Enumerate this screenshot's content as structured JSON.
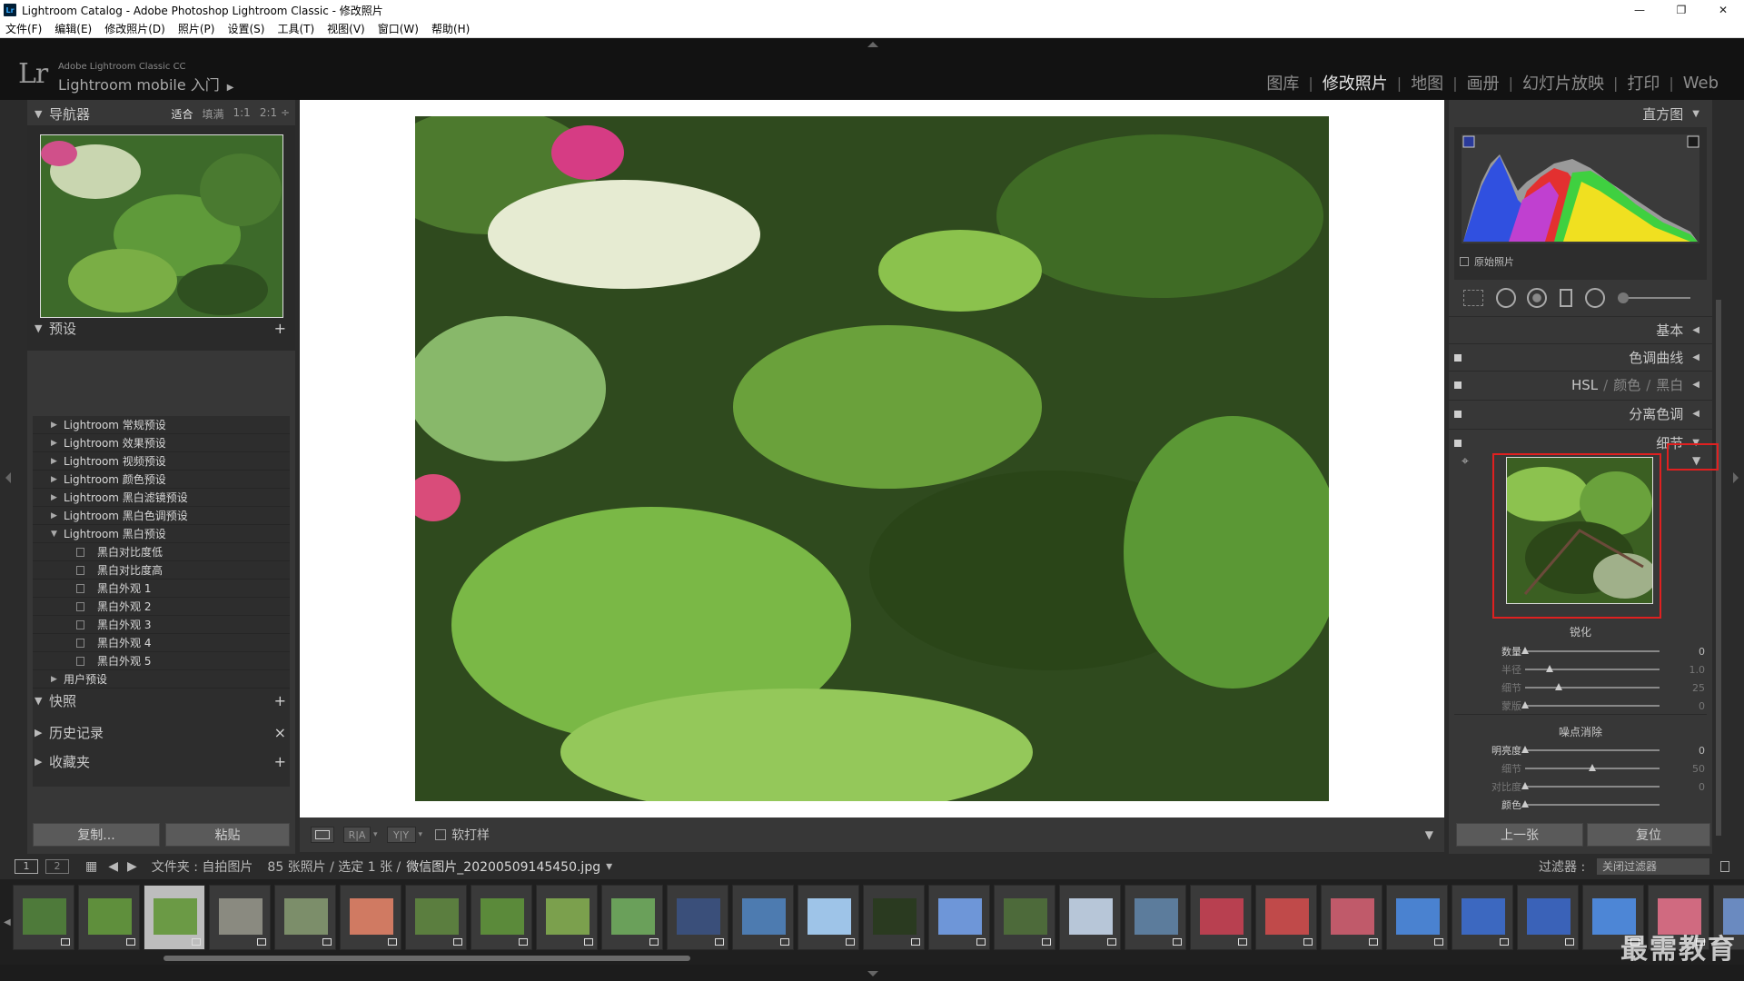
{
  "window": {
    "title": "Lightroom Catalog - Adobe Photoshop Lightroom Classic - 修改照片",
    "app_badge": "Lr",
    "controls": [
      "—",
      "❐",
      "✕"
    ]
  },
  "menubar": [
    "文件(F)",
    "编辑(E)",
    "修改照片(D)",
    "照片(P)",
    "设置(S)",
    "工具(T)",
    "视图(V)",
    "窗口(W)",
    "帮助(H)"
  ],
  "identity": {
    "logo": "Lr",
    "small": "Adobe Lightroom Classic CC",
    "big": "Lightroom mobile 入门",
    "play_icon": "▶"
  },
  "modules": [
    {
      "label": "图库",
      "active": false
    },
    {
      "label": "修改照片",
      "active": true
    },
    {
      "label": "地图",
      "active": false
    },
    {
      "label": "画册",
      "active": false
    },
    {
      "label": "幻灯片放映",
      "active": false
    },
    {
      "label": "打印",
      "active": false
    },
    {
      "label": "Web",
      "active": false
    }
  ],
  "left": {
    "navigator": {
      "title": "导航器",
      "options": [
        "适合",
        "填满",
        "1:1",
        "2:1 ÷"
      ],
      "current": "适合"
    },
    "presets": {
      "title": "预设",
      "groups": [
        "Lightroom 常规预设",
        "Lightroom 效果预设",
        "Lightroom 视频预设",
        "Lightroom 颜色预设",
        "Lightroom 黑白滤镜预设",
        "Lightroom 黑白色调预设"
      ],
      "open_group": "Lightroom 黑白预设",
      "children": [
        "黑白对比度低",
        "黑白对比度高",
        "黑白外观 1",
        "黑白外观 2",
        "黑白外观 3",
        "黑白外观 4",
        "黑白外观 5"
      ],
      "user_group": "用户预设"
    },
    "snapshots": "快照",
    "history": "历史记录",
    "collections": "收藏夹",
    "copy_button": "复制...",
    "paste_button": "粘贴"
  },
  "toolbar": {
    "view_ra": "R|A",
    "view_yy": "Y|Y",
    "softproof_label": "软打样"
  },
  "right": {
    "histogram_title": "直方图",
    "original_photo": "原始照片",
    "panels": {
      "basic": "基本",
      "tone_curve": "色调曲线",
      "hsl_parts": [
        "HSL",
        "/",
        "颜色",
        "/",
        "黑白"
      ],
      "split_toning": "分离色调",
      "detail": "细节"
    },
    "sharpening": {
      "title": "锐化",
      "rows": [
        {
          "label": "数量",
          "value": "0",
          "pos": 0.0
        },
        {
          "label": "半径",
          "value": "1.0",
          "pos": 0.18
        },
        {
          "label": "细节",
          "value": "25",
          "pos": 0.25
        },
        {
          "label": "蒙版",
          "value": "0",
          "pos": 0.0
        }
      ]
    },
    "noise": {
      "title": "噪点消除",
      "rows": [
        {
          "label": "明亮度",
          "value": "0",
          "pos": 0.0
        },
        {
          "label": "细节",
          "value": "50",
          "pos": 0.5
        },
        {
          "label": "对比度",
          "value": "0",
          "pos": 0.0
        },
        {
          "label": "颜色",
          "value": "",
          "pos": 0.0
        }
      ]
    },
    "prev_button": "上一张",
    "reset_button": "复位"
  },
  "filmbar": {
    "page1": "1",
    "page2": "2",
    "source": "文件夹 : 自拍图片",
    "count": "85 张照片 / 选定 1 张 /",
    "filename": "微信图片_20200509145450.jpg",
    "dropdown": "▾",
    "filter_label": "过滤器 :",
    "filter_value": "关闭过滤器"
  },
  "filmstrip_colors": [
    "#4e7a3a",
    "#5f8f3c",
    "#6b9a45",
    "#8a8a80",
    "#7c8e6a",
    "#d07a62",
    "#5b7e3f",
    "#5b8a3a",
    "#7ba04d",
    "#6aa05a",
    "#3a4f7a",
    "#4d7bb0",
    "#9ec4e8",
    "#2a3a20",
    "#6e96d8",
    "#4d6a3a",
    "#b7c6d8",
    "#5c7c9c",
    "#b84050",
    "#c04a4a",
    "#c05a6a",
    "#4a82d0",
    "#3c68c0",
    "#3a62b8",
    "#4d86d6",
    "#d06a80",
    "#6a8ac0"
  ],
  "watermark": "最需教育"
}
